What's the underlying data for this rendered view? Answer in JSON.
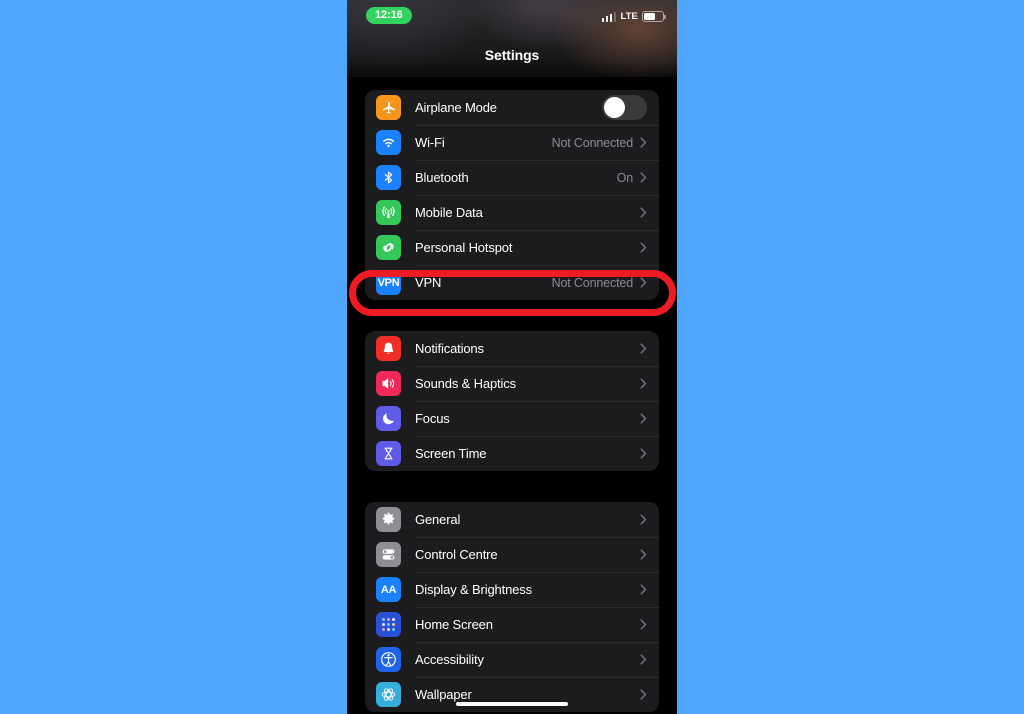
{
  "background_color": "#4FA6FC",
  "status_bar": {
    "time": "12:16",
    "time_pill_color": "#32D35E",
    "carrier_label": "LTE",
    "signal_icon": "signal-bars-icon",
    "battery_icon": "battery-icon"
  },
  "header": {
    "title": "Settings"
  },
  "annotation": {
    "color": "#ED1C24",
    "target": "VPN"
  },
  "groups": [
    {
      "id": "connectivity",
      "rows": [
        {
          "label": "Airplane Mode",
          "icon": "airplane-icon",
          "icon_color": "#F6941E",
          "control": "toggle",
          "toggle_on": false,
          "value": ""
        },
        {
          "label": "Wi-Fi",
          "icon": "wifi-icon",
          "icon_color": "#1A82FF",
          "control": "chevron",
          "value": "Not Connected"
        },
        {
          "label": "Bluetooth",
          "icon": "bluetooth-icon",
          "icon_color": "#1A82FF",
          "control": "chevron",
          "value": "On"
        },
        {
          "label": "Mobile Data",
          "icon": "mobile-data-icon",
          "icon_color": "#34C759",
          "control": "chevron",
          "value": ""
        },
        {
          "label": "Personal Hotspot",
          "icon": "hotspot-link-icon",
          "icon_color": "#34C759",
          "control": "chevron",
          "value": ""
        },
        {
          "label": "VPN",
          "icon": "vpn-icon",
          "icon_color": "#1A82FF",
          "control": "chevron",
          "value": "Not Connected",
          "highlighted": true
        }
      ]
    },
    {
      "id": "alerts",
      "rows": [
        {
          "label": "Notifications",
          "icon": "bell-icon",
          "icon_color": "#F02E25",
          "control": "chevron",
          "value": ""
        },
        {
          "label": "Sounds & Haptics",
          "icon": "speaker-icon",
          "icon_color": "#F0295B",
          "control": "chevron",
          "value": ""
        },
        {
          "label": "Focus",
          "icon": "moon-icon",
          "icon_color": "#5E5CE6",
          "control": "chevron",
          "value": ""
        },
        {
          "label": "Screen Time",
          "icon": "hourglass-icon",
          "icon_color": "#5E5CE6",
          "control": "chevron",
          "value": ""
        }
      ]
    },
    {
      "id": "system",
      "rows": [
        {
          "label": "General",
          "icon": "gear-icon",
          "icon_color": "#8E8E93",
          "control": "chevron",
          "value": ""
        },
        {
          "label": "Control Centre",
          "icon": "control-centre-icon",
          "icon_color": "#8E8E93",
          "control": "chevron",
          "value": ""
        },
        {
          "label": "Display & Brightness",
          "icon": "display-brightness-icon",
          "icon_color": "#1A82FF",
          "control": "chevron",
          "value": ""
        },
        {
          "label": "Home Screen",
          "icon": "home-screen-icon",
          "icon_color": "#2B50D8",
          "control": "chevron",
          "value": ""
        },
        {
          "label": "Accessibility",
          "icon": "accessibility-icon",
          "icon_color": "#1F63E8",
          "control": "chevron",
          "value": ""
        },
        {
          "label": "Wallpaper",
          "icon": "wallpaper-icon",
          "icon_color": "#35AEDB",
          "control": "chevron",
          "value": ""
        }
      ]
    }
  ]
}
